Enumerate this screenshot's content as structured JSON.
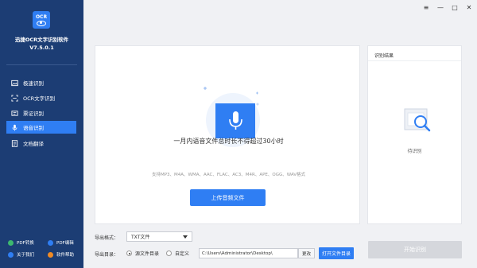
{
  "app": {
    "name": "迅捷OCR文字识别软件",
    "version": "V7.5.0.1",
    "logo_text": "OCR"
  },
  "window_controls": [
    "≡",
    "—",
    "□",
    "✕"
  ],
  "sidebar": {
    "items": [
      {
        "label": "极速识别",
        "icon": "image-icon",
        "active": false
      },
      {
        "label": "OCR文字识别",
        "icon": "scan-icon",
        "active": false
      },
      {
        "label": "票证识别",
        "icon": "ticket-icon",
        "active": false
      },
      {
        "label": "语音识别",
        "icon": "microphone-icon",
        "active": true
      },
      {
        "label": "文档翻译",
        "icon": "translate-icon",
        "active": false
      }
    ],
    "links": [
      {
        "label": "PDF转换",
        "color": "#3db86f"
      },
      {
        "label": "PDF编辑",
        "color": "#2f7ef3"
      },
      {
        "label": "关于我们",
        "color": "#2f7ef3"
      },
      {
        "label": "软件帮助",
        "color": "#f08a24"
      }
    ]
  },
  "main": {
    "title": "一月内语音文件总时长不得超过30小时",
    "subtitle": "支持MP3、M4A、WMA、AAC、FLAC、AC3、M4R、APE、OGG、WAV格式",
    "upload_label": "上传音频文件"
  },
  "result": {
    "title": "识别结果",
    "empty_text": "待识别"
  },
  "output": {
    "format_label": "导出格式：",
    "format_value": "TXT文件",
    "dir_label": "导出目录：",
    "radio_source": "源文件目录",
    "radio_custom": "自定义",
    "path_value": "C:\\Users\\Administrator\\Desktop\\",
    "change_label": "更改",
    "open_dir_label": "打开文件目录",
    "start_label": "开始识别"
  },
  "colors": {
    "sidebar_bg": "#1c3d74",
    "accent": "#2f7ef3",
    "disabled": "#d5d7dc"
  }
}
